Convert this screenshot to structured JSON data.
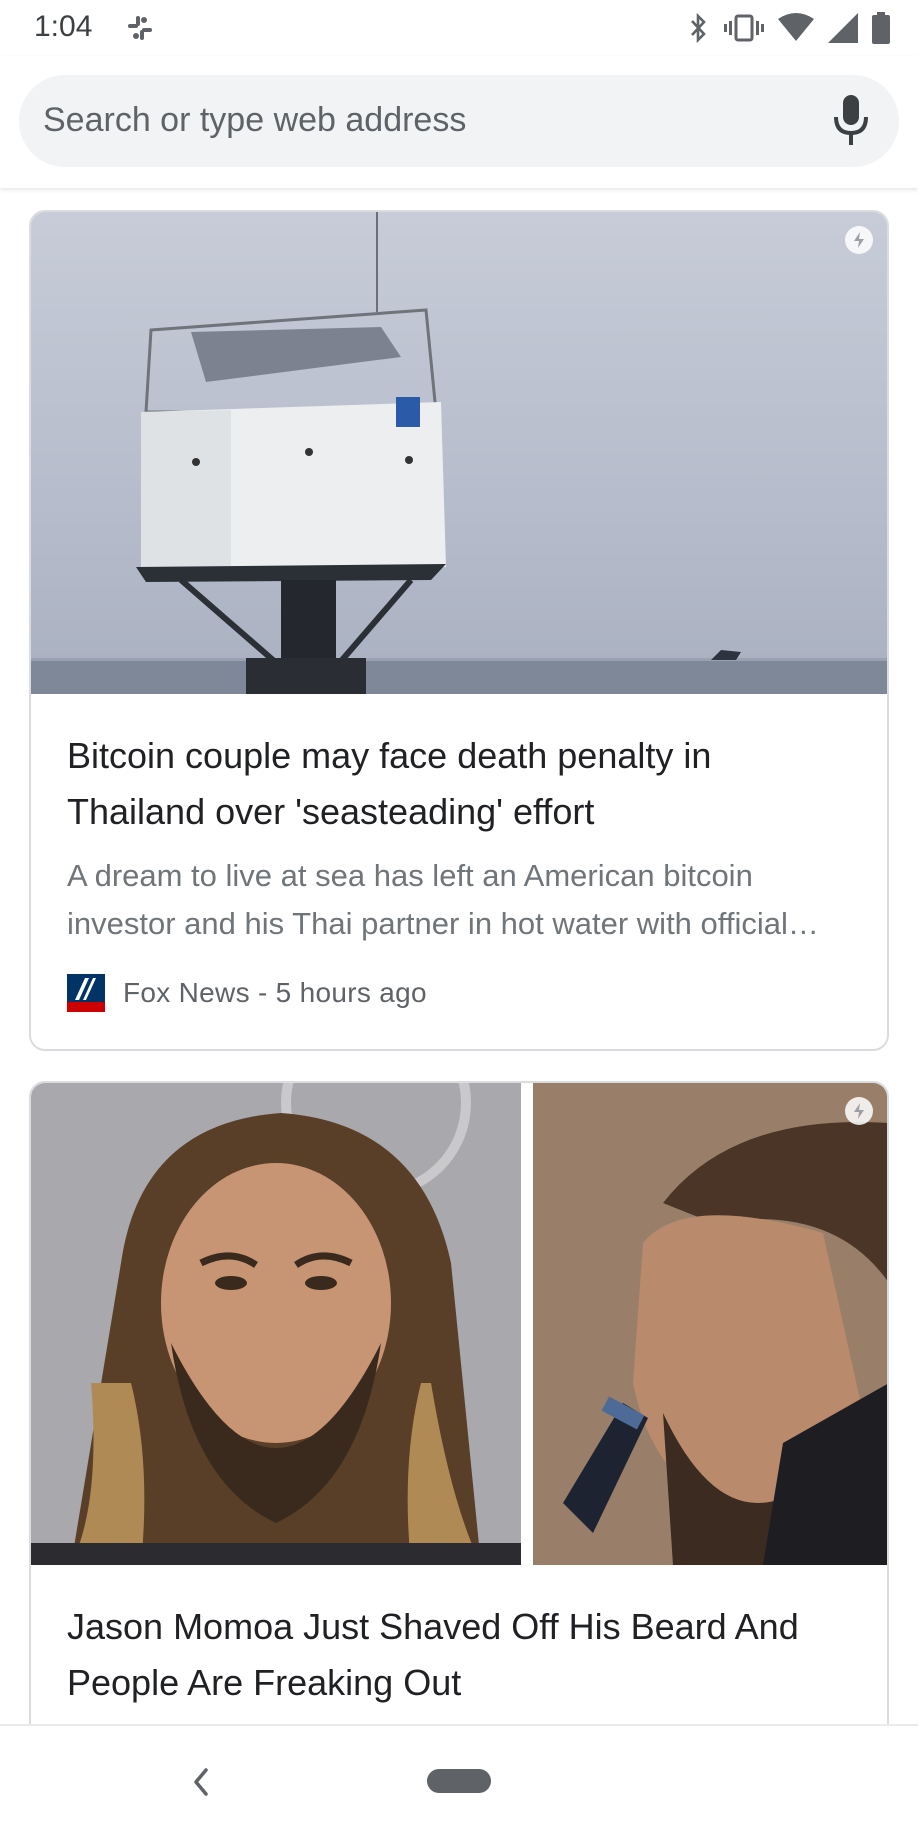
{
  "status_bar": {
    "time": "1:04",
    "app_icon": "slack-icon",
    "icons": [
      "bluetooth-icon",
      "vibrate-icon",
      "wifi-icon",
      "cell-signal-icon",
      "battery-icon"
    ]
  },
  "search": {
    "placeholder": "Search or type web address",
    "mic_icon": "mic-icon"
  },
  "feed": {
    "cards": [
      {
        "title": "Bitcoin couple may face death penalty in Thailand over 'seasteading' effort",
        "snippet": "A dream to live at sea has left an American bitcoin investor and his Thai partner in hot water with official…",
        "source": "Fox News - 5 hours ago",
        "source_logo": "fox-news-logo",
        "badge_icon": "amp-lightning-icon"
      },
      {
        "title": "Jason Momoa Just Shaved Off His Beard And People Are Freaking Out",
        "badge_icon": "amp-lightning-icon"
      }
    ]
  },
  "nav": {
    "back_icon": "back-chevron-icon",
    "home_icon": "home-pill-icon"
  },
  "colors": {
    "search_bg": "#f1f3f4",
    "card_border": "#dadce0",
    "title_text": "#202124",
    "snippet_text": "#70757a"
  }
}
